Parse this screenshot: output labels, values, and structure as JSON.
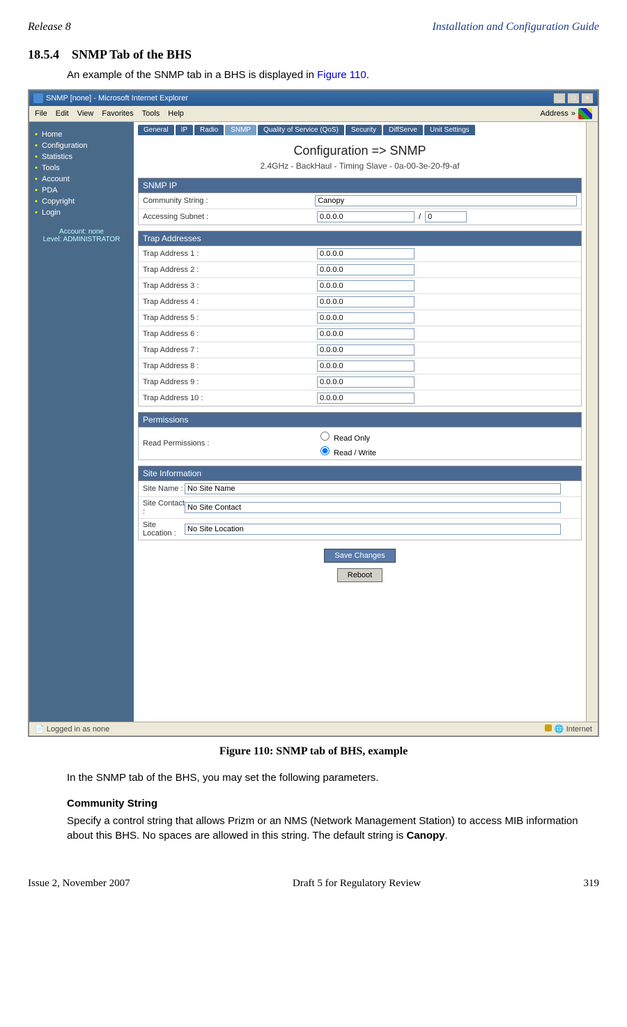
{
  "header": {
    "left": "Release 8",
    "right": "Installation and Configuration Guide"
  },
  "section": {
    "number": "18.5.4",
    "title": "SNMP Tab of the BHS"
  },
  "intro": {
    "pre": "An example of the SNMP tab in a BHS is displayed in ",
    "link": "Figure 110",
    "post": "."
  },
  "screenshot": {
    "window_title": "SNMP [none] - Microsoft Internet Explorer",
    "menus": [
      "File",
      "Edit",
      "View",
      "Favorites",
      "Tools",
      "Help"
    ],
    "address_label": "Address",
    "sidebar": {
      "items": [
        "Home",
        "Configuration",
        "Statistics",
        "Tools",
        "Account",
        "PDA",
        "Copyright",
        "Login"
      ],
      "account_line1": "Account: none",
      "account_line2": "Level: ADMINISTRATOR"
    },
    "tabs": [
      "General",
      "IP",
      "Radio",
      "SNMP",
      "Quality of Service (QoS)",
      "Security",
      "DiffServe",
      "Unit Settings"
    ],
    "page_title": "Configuration => SNMP",
    "subtitle": "2.4GHz - BackHaul - Timing Slave - 0a-00-3e-20-f9-af",
    "snmp_ip": {
      "header": "SNMP IP",
      "community_label": "Community String :",
      "community_value": "Canopy",
      "subnet_label": "Accessing Subnet :",
      "subnet_ip": "0.0.0.0",
      "subnet_sep": "/",
      "subnet_mask": "0"
    },
    "trap": {
      "header": "Trap Addresses",
      "rows": [
        {
          "label": "Trap Address 1 :",
          "value": "0.0.0.0"
        },
        {
          "label": "Trap Address 2 :",
          "value": "0.0.0.0"
        },
        {
          "label": "Trap Address 3 :",
          "value": "0.0.0.0"
        },
        {
          "label": "Trap Address 4 :",
          "value": "0.0.0.0"
        },
        {
          "label": "Trap Address 5 :",
          "value": "0.0.0.0"
        },
        {
          "label": "Trap Address 6 :",
          "value": "0.0.0.0"
        },
        {
          "label": "Trap Address 7 :",
          "value": "0.0.0.0"
        },
        {
          "label": "Trap Address 8 :",
          "value": "0.0.0.0"
        },
        {
          "label": "Trap Address 9 :",
          "value": "0.0.0.0"
        },
        {
          "label": "Trap Address 10 :",
          "value": "0.0.0.0"
        }
      ]
    },
    "permissions": {
      "header": "Permissions",
      "label": "Read Permissions :",
      "opt1": "Read Only",
      "opt2": "Read / Write"
    },
    "site": {
      "header": "Site Information",
      "rows": [
        {
          "label": "Site Name :",
          "value": "No Site Name"
        },
        {
          "label": "Site Contact :",
          "value": "No Site Contact"
        },
        {
          "label": "Site Location :",
          "value": "No Site Location"
        }
      ]
    },
    "buttons": {
      "save": "Save Changes",
      "reboot": "Reboot"
    },
    "status": {
      "left": "Logged in as none",
      "right": "Internet"
    }
  },
  "caption": "Figure 110: SNMP tab of BHS, example",
  "after_text": "In the SNMP tab of the BHS, you may set the following parameters.",
  "param1": {
    "head": "Community String",
    "body_pre": "Specify a control string that allows Prizm or an NMS (Network Management Station) to access MIB information about this BHS. No spaces are allowed in this string. The default string is ",
    "body_bold": "Canopy",
    "body_post": "."
  },
  "footer": {
    "left": "Issue 2, November 2007",
    "center": "Draft 5 for Regulatory Review",
    "right": "319"
  }
}
